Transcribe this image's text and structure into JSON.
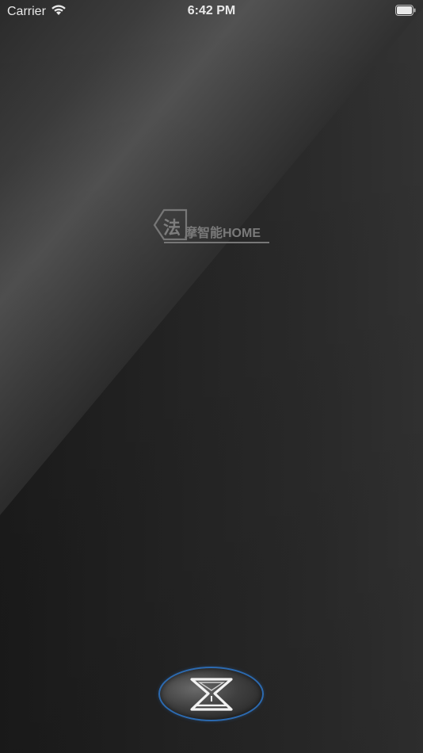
{
  "status_bar": {
    "carrier": "Carrier",
    "time": "6:42 PM",
    "wifi_icon": "wifi-icon",
    "battery_icon": "battery-icon"
  },
  "logo": {
    "badge_char": "法",
    "text": "摩智能HOME"
  },
  "home_button": {
    "icon": "hourglass-logo-icon",
    "accent_color": "#2c6ab0"
  },
  "colors": {
    "background": "#262626",
    "logo": "#7a7a7a",
    "status_text": "#e8e8e8"
  }
}
